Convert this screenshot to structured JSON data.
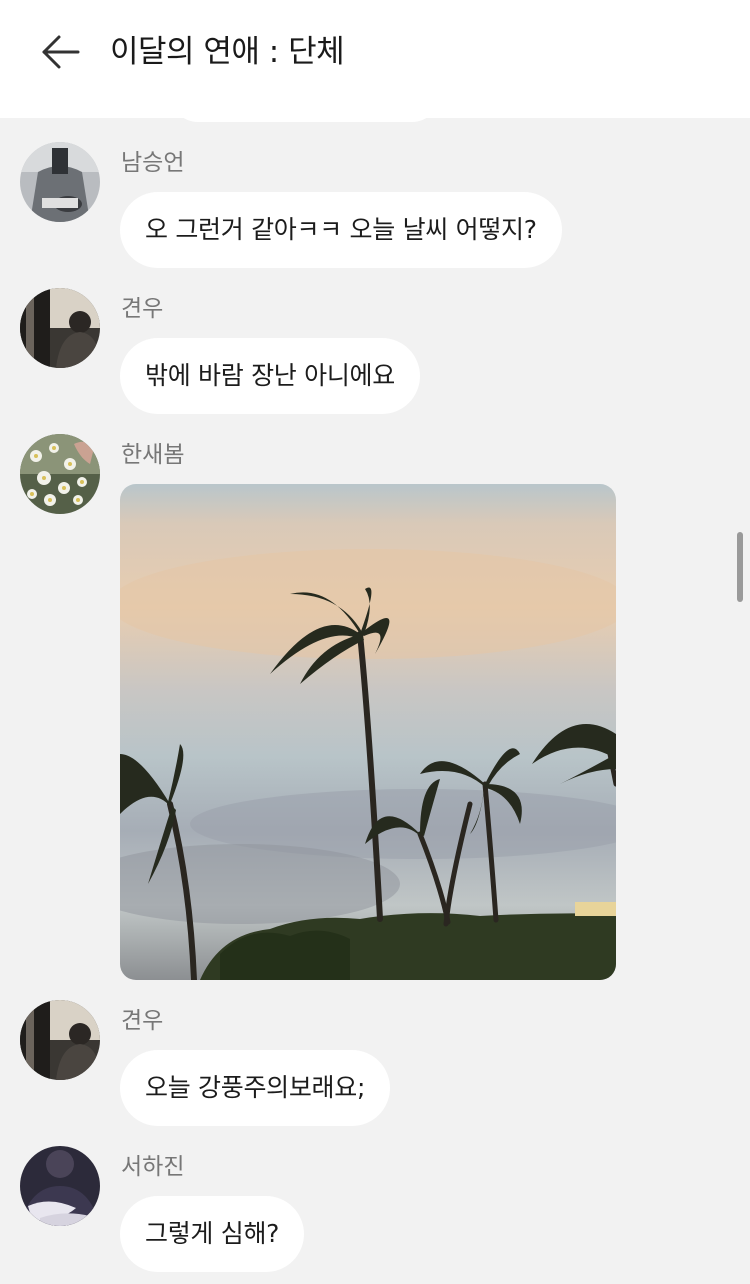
{
  "header": {
    "title": "이달의 연애 : 단체",
    "back_icon": "arrow-left-icon"
  },
  "messages": [
    {
      "sender": "남승언",
      "type": "text",
      "text": "오 그런거 같아ㅋㅋ 오늘 날씨 어떻지?"
    },
    {
      "sender": "견우",
      "type": "text",
      "text": "밖에 바람 장난 아니에요"
    },
    {
      "sender": "한새봄",
      "type": "image",
      "image": "windy-palm-trees-photo"
    },
    {
      "sender": "견우",
      "type": "text",
      "text": "오늘 강풍주의보래요;"
    },
    {
      "sender": "서하진",
      "type": "text",
      "text": "그렇게 심해?"
    }
  ],
  "colors": {
    "background": "#f2f2f2",
    "bubble": "#ffffff",
    "sender_text": "#777777",
    "message_text": "#1c1c1c"
  }
}
